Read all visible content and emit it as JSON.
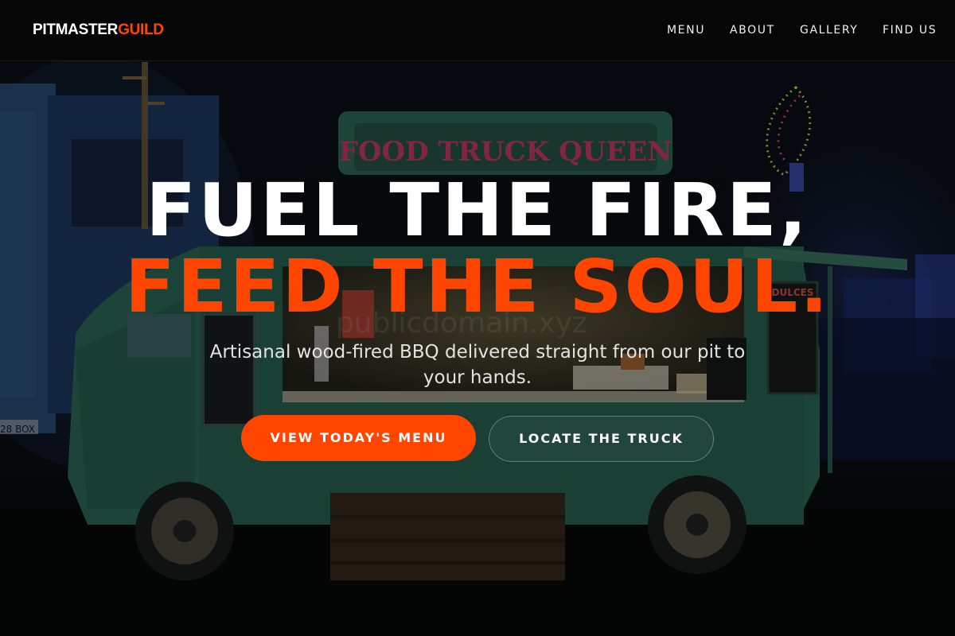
{
  "brand": {
    "logo_part1": "PITMASTER",
    "logo_part2": "GUILD",
    "accent_color": "#ff4500"
  },
  "nav": {
    "items": [
      {
        "label": "MENU"
      },
      {
        "label": "ABOUT"
      },
      {
        "label": "GALLERY"
      },
      {
        "label": "FIND US"
      }
    ]
  },
  "hero": {
    "headline_line1": "FUEL THE FIRE,",
    "headline_line2": "FEED THE SOUL.",
    "subtitle": "Artisanal wood-fired BBQ delivered straight from our pit to your hands.",
    "primary_cta": "VIEW TODAY'S MENU",
    "secondary_cta": "LOCATE THE TRUCK",
    "background": {
      "truck_sign": "FOOD TRUCK QUEEN",
      "side_board": "DULCES",
      "plate_text": "28 BOX",
      "watermark": "publicdomain.xyz"
    }
  }
}
